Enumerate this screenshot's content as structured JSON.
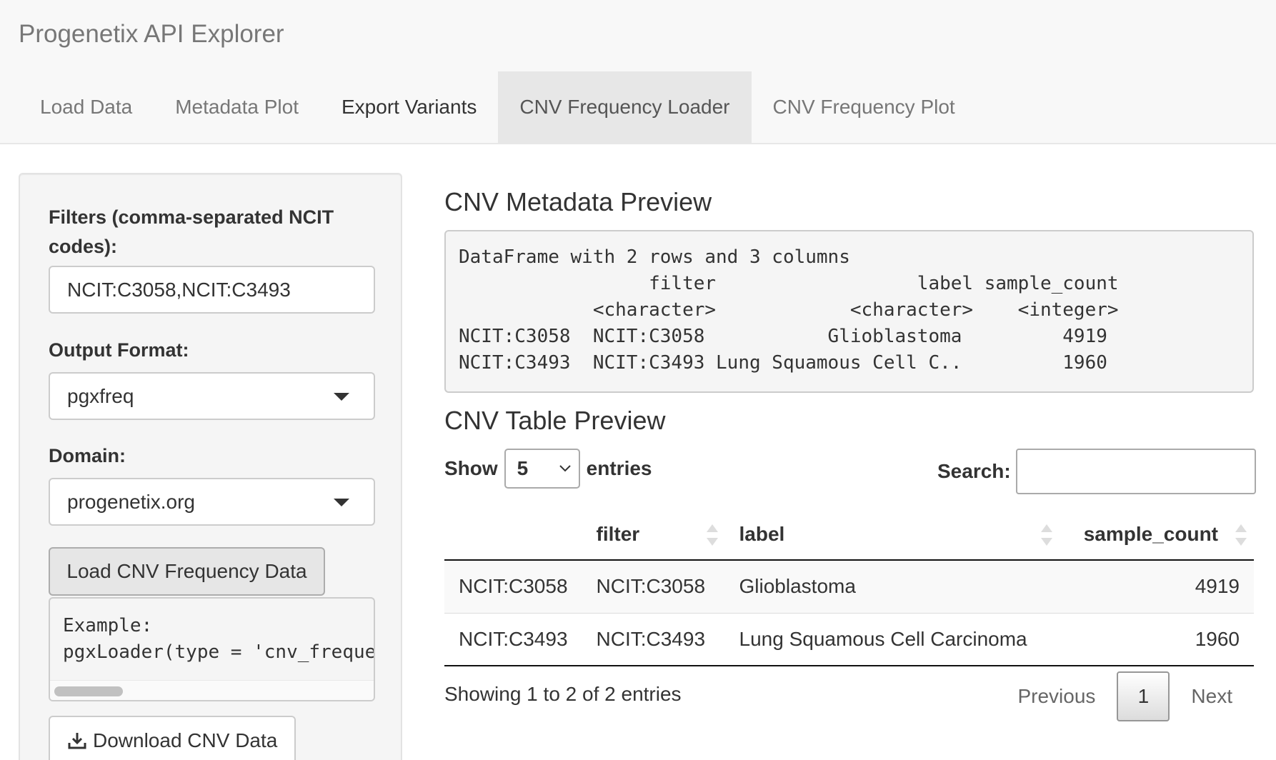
{
  "app": {
    "title": "Progenetix API Explorer"
  },
  "tabs": [
    {
      "label": "Load Data"
    },
    {
      "label": "Metadata Plot"
    },
    {
      "label": "Export Variants"
    },
    {
      "label": "CNV Frequency Loader"
    },
    {
      "label": "CNV Frequency Plot"
    }
  ],
  "sidebar": {
    "filters_label": "Filters (comma-separated NCIT codes):",
    "filters_value": "NCIT:C3058,NCIT:C3493",
    "output_format_label": "Output Format:",
    "output_format_value": "pgxfreq",
    "domain_label": "Domain:",
    "domain_value": "progenetix.org",
    "load_button": "Load CNV Frequency Data",
    "example_code": "Example:\npgxLoader(type = 'cnv_freque",
    "download_button": "Download CNV Data"
  },
  "main": {
    "metadata_title": "CNV Metadata Preview",
    "metadata_output": "DataFrame with 2 rows and 3 columns\n                 filter                  label sample_count\n            <character>            <character>    <integer>\nNCIT:C3058  NCIT:C3058           Glioblastoma         4919\nNCIT:C3493  NCIT:C3493 Lung Squamous Cell C..         1960",
    "table_title": "CNV Table Preview",
    "show_label": "Show",
    "entries_value": "5",
    "entries_label": "entries",
    "search_label": "Search:",
    "search_value": "",
    "columns": [
      "",
      "filter",
      "label",
      "sample_count"
    ],
    "rows": [
      [
        "NCIT:C3058",
        "NCIT:C3058",
        "Glioblastoma",
        "4919"
      ],
      [
        "NCIT:C3493",
        "NCIT:C3493",
        "Lung Squamous Cell Carcinoma",
        "1960"
      ]
    ],
    "info": "Showing 1 to 2 of 2 entries",
    "pagination": {
      "previous": "Previous",
      "current": "1",
      "next": "Next"
    }
  }
}
